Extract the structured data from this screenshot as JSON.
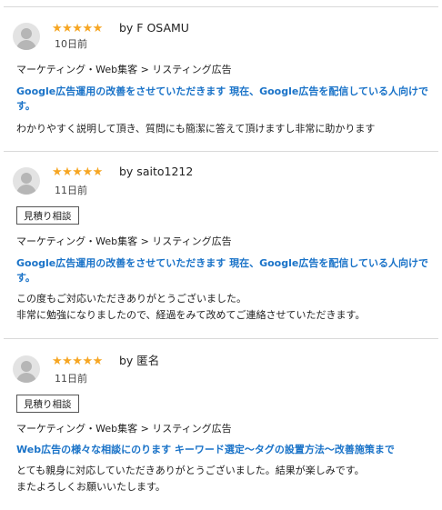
{
  "star_color": "#f6a623",
  "title_color": "#1a73c8",
  "reviews": [
    {
      "stars": "★★★★★",
      "author": "by F OSAMU",
      "date": "10日前",
      "category": "マーケティング・Web集客 > リスティング広告",
      "title": "Google広告運用の改善をさせていただきます 現在、Google広告を配信している人向けです。",
      "comment": "わかりやすく説明して頂き、質問にも簡潔に答えて頂けますし非常に助かります"
    },
    {
      "stars": "★★★★★",
      "author": "by saito1212",
      "date": "11日前",
      "tag": "見積り相談",
      "category": "マーケティング・Web集客 > リスティング広告",
      "title": "Google広告運用の改善をさせていただきます 現在、Google広告を配信している人向けです。",
      "comment": "この度もご対応いただきありがとうございました。\n非常に勉強になりましたので、経過をみて改めてご連絡させていただきます。"
    },
    {
      "stars": "★★★★★",
      "author": "by 匿名",
      "date": "11日前",
      "tag": "見積り相談",
      "category": "マーケティング・Web集客 > リスティング広告",
      "title": "Web広告の様々な相談にのります キーワード選定〜タグの設置方法〜改善施策まで",
      "comment": "とても親身に対応していただきありがとうございました。結果が楽しみです。\nまたよろしくお願いいたします。"
    }
  ]
}
